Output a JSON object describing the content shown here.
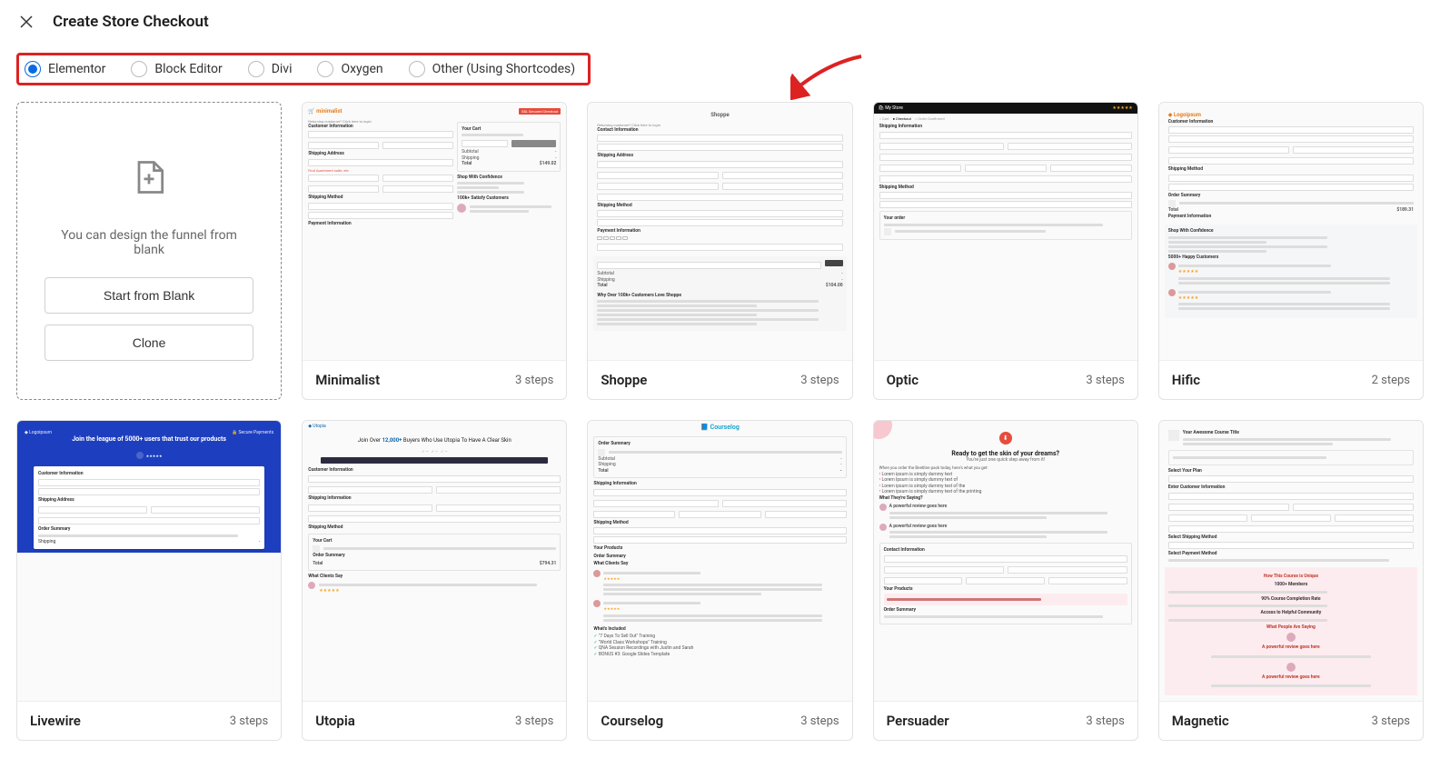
{
  "header": {
    "title": "Create Store Checkout"
  },
  "editors": {
    "selected": "Elementor",
    "options": [
      "Elementor",
      "Block Editor",
      "Divi",
      "Oxygen",
      "Other (Using Shortcodes)"
    ]
  },
  "blank_card": {
    "text": "You can design the funnel from blank",
    "start_label": "Start from Blank",
    "clone_label": "Clone"
  },
  "templates": [
    {
      "name": "Minimalist",
      "steps": "3 steps"
    },
    {
      "name": "Shoppe",
      "steps": "3 steps"
    },
    {
      "name": "Optic",
      "steps": "3 steps"
    },
    {
      "name": "Hific",
      "steps": "2 steps"
    },
    {
      "name": "Livewire",
      "steps": "3 steps"
    },
    {
      "name": "Utopia",
      "steps": "3 steps"
    },
    {
      "name": "Courselog",
      "steps": "3 steps"
    },
    {
      "name": "Persuader",
      "steps": "3 steps"
    },
    {
      "name": "Magnetic",
      "steps": "3 steps"
    }
  ],
  "preview": {
    "minimalist": {
      "logo": "minimalist",
      "badge": "SSL Secured Checkout",
      "returning": "Returning customer? Click here to login",
      "h_customer": "Customer Information",
      "h_shipping": "Shipping Address",
      "alert": "Find Apartment suite, etc",
      "h_method": "Shipping Method",
      "h_payment": "Payment Information",
      "cart_header": "Your Cart",
      "subtotal": "Subtotal",
      "shipping": "Shipping",
      "total": "Total",
      "total_val": "$149.02",
      "confidence": "Shop With Confidence",
      "customers": "100k+ Satisfy Customers"
    },
    "shoppe": {
      "logo": "Shoppe",
      "returning": "Returning customer? Click here to login",
      "h_contact": "Contact Information",
      "h_shipping": "Shipping Address",
      "h_method": "Shipping Method",
      "h_payment": "Payment Information",
      "subtotal": "Subtotal",
      "shipping": "Shipping",
      "total": "Total",
      "total_val": "$104.00",
      "why_header": "Why Over 100k+ Customers Love Shoppe",
      "apply": "Apply"
    },
    "optic": {
      "logo": "My Store",
      "steps": [
        "Cart",
        "Checkout",
        "Order Confirmed"
      ],
      "h_shipping": "Shipping Information",
      "h_method": "Shipping Method",
      "right_header": "Your order"
    },
    "hific": {
      "logo": "Logoipsum",
      "h_customer": "Customer Information",
      "h_method": "Shipping Method",
      "h_summary": "Order Summary",
      "h_payment": "Payment Information",
      "total": "Total",
      "total_val": "$189.31",
      "confidence": "Shop With Confidence",
      "happy": "5000+ Happy Customers"
    },
    "livewire": {
      "logo": "Logoipsum",
      "secure": "Secure Payments",
      "headline": "Join the league of 5000+ users that trust our products",
      "h_customer": "Customer Information",
      "h_shipping": "Shipping Address",
      "h_summary": "Order Summary",
      "shipping": "Shipping"
    },
    "utopia": {
      "brand": "Utopia",
      "headline_pre": "Join Over ",
      "headline_bold": "12,000+",
      "headline_post": " Buyers Who Use Utopia To Have A Clear Skin",
      "h_customer": "Customer Information",
      "h_shipping": "Shipping Information",
      "h_method": "Shipping Method",
      "cart_header": "Your Cart",
      "summary": "Order Summary",
      "total": "Total",
      "total_val": "$794.31",
      "clients": "What Clients Say"
    },
    "courselog": {
      "brand": "Courselog",
      "h_summary": "Order Summary",
      "subtotal": "Subtotal",
      "shipping": "Shipping",
      "total": "Total",
      "h_shipinfo": "Shipping Information",
      "h_method": "Shipping Method",
      "h_products": "Your Products",
      "h_ordersum": "Order Summary",
      "clients": "What Clients Say",
      "included": "What's Included",
      "inc1": "\"7 Days To Sell Out\" Training",
      "inc2": "\"World Class Workshops\" Training",
      "inc3": "QNA Session Recordings with Justin and Sarah",
      "inc4": "BONUS #3: Google Slides Template"
    },
    "persuader": {
      "headline": "Ready to get the skin of your dreams?",
      "sub": "You're just one quick step away from it!",
      "order_intro": "When you order the Beetline pack today, here's what you get:",
      "b1": "Lorem ipsum is simply dummy text",
      "b2": "Lorem Ipsum is simply dummy text of",
      "b3": "Lorem ipsum is simply dummy text of the",
      "b4": "Lorem ipsum is simply dummy text of the printing",
      "saying": "What They're Saying?",
      "rev": "A powerful review goes here",
      "contact": "Contact Information",
      "products": "Your Products",
      "ordersum": "Order Summary"
    },
    "magnetic": {
      "course": "Your Awesome Course Title",
      "h_plan": "Select Your Plan",
      "h_customer": "Enter Customer Information",
      "h_method": "Select Shipping Method",
      "h_payment": "Select Payment Method",
      "side_h1": "How This Course is Unique",
      "stat1": "1000+ Members",
      "stat2": "90% Course Completion Rate",
      "stat3": "Access to Helpful Community",
      "side_h2": "What People Are Saying",
      "rev": "A powerful review goes here"
    }
  }
}
